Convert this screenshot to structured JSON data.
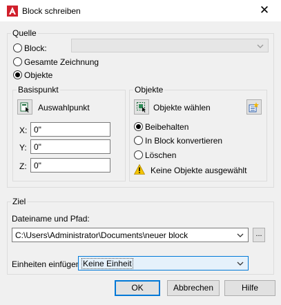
{
  "window": {
    "title": "Block schreiben",
    "close_glyph": "✕"
  },
  "source": {
    "label": "Quelle",
    "radio_block": "Block:",
    "radio_whole": "Gesamte Zeichnung",
    "radio_objects": "Objekte",
    "block_combo_value": ""
  },
  "basepoint": {
    "label": "Basispunkt",
    "pick_label": "Auswahlpunkt",
    "x_label": "X:",
    "x_value": "0\"",
    "y_label": "Y:",
    "y_value": "0\"",
    "z_label": "Z:",
    "z_value": "0\""
  },
  "objects": {
    "label": "Objekte",
    "select_label": "Objekte wählen",
    "retain": "Beibehalten",
    "convert": "In Block konvertieren",
    "delete": "Löschen",
    "warning": "Keine Objekte ausgewählt"
  },
  "destination": {
    "label": "Ziel",
    "path_label": "Dateiname und Pfad:",
    "path_value": "C:\\Users\\Administrator\\Documents\\neuer block",
    "browse_label": "...",
    "units_label": "Einheiten einfügen:",
    "units_value": "Keine Einheit"
  },
  "buttons": {
    "ok": "OK",
    "cancel": "Abbrechen",
    "help": "Hilfe"
  },
  "colors": {
    "accent": "#0078d7",
    "app_red": "#d0202c",
    "warning_yellow": "#f5c400"
  }
}
